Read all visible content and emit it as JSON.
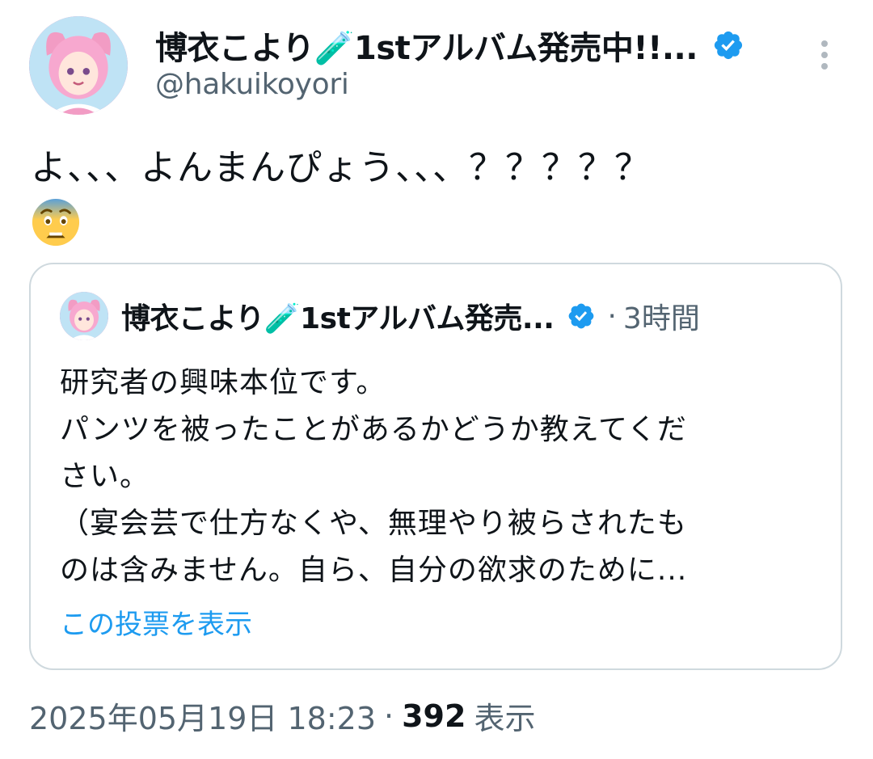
{
  "author": {
    "display_name": "博衣こより🧪1stアルバム発売中!!...",
    "handle": "@hakuikoyori",
    "avatar_icon": "avatar-image",
    "verified_icon": "verified-badge-icon"
  },
  "menu_icon": "more-vertical-icon",
  "tweet": {
    "text_line1": "よ、、、よんまんぴょう、、、？？？？？",
    "emoji": "fearful-face-emoji"
  },
  "quote": {
    "display_name": "博衣こより🧪1stアルバム発売...",
    "separator": "·",
    "time": "3時間",
    "lines": [
      "研究者の興味本位です。",
      "パンツを被ったことがあるかどうか教えてくだ",
      "さい。",
      "（宴会芸で仕方なくや、無理やり被らされたも",
      "のは含みません。自ら、自分の欲求のために..."
    ],
    "poll_link": "この投票を表示"
  },
  "footer": {
    "timestamp": "2025年05月19日 18:23",
    "separator": "·",
    "views_count": "392",
    "views_label": "表示"
  },
  "colors": {
    "accent": "#1d9bf0",
    "secondary_text": "#536471",
    "border": "#cfd9de"
  }
}
